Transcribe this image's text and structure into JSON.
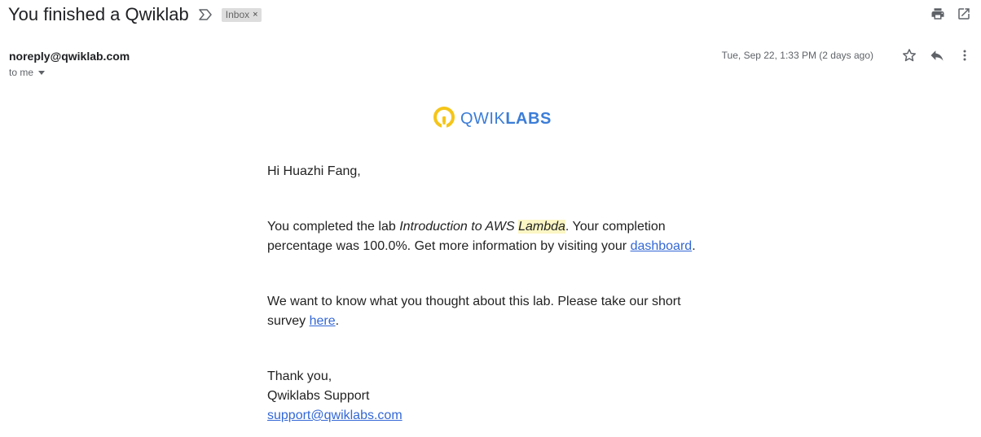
{
  "email": {
    "subject": "You finished a Qwiklab",
    "label": "Inbox",
    "label_close": "×",
    "sender": "noreply@qwiklab.com",
    "recipient": "to me",
    "date": "Tue, Sep 22, 1:33 PM (2 days ago)"
  },
  "icons": {
    "important": "important-marker-icon",
    "print": "print-icon",
    "open_new_window": "open-in-new-window-icon",
    "star": "star-icon",
    "reply": "reply-icon",
    "more": "more-vert-icon"
  },
  "logo": {
    "part1": "QWIK",
    "part2": "LABS",
    "colors": {
      "ring": "#f5c518",
      "text": "#3b7dd8"
    }
  },
  "body": {
    "greeting": "Hi Huazhi Fang,",
    "p2_a": "You completed the lab ",
    "p2_lab_a": "Introduction to AWS ",
    "p2_lab_b": "Lambda",
    "p2_b": ". Your completion percentage was 100.0%. Get more information by visiting your ",
    "p2_link": "dashboard",
    "p2_c": ".",
    "p3_a": "We want to know what you thought about this lab. Please take our short survey ",
    "p3_link": "here",
    "p3_b": ".",
    "sign_1": "Thank you,",
    "sign_2": "Qwiklabs Support",
    "sign_email": "support@qwiklabs.com"
  }
}
